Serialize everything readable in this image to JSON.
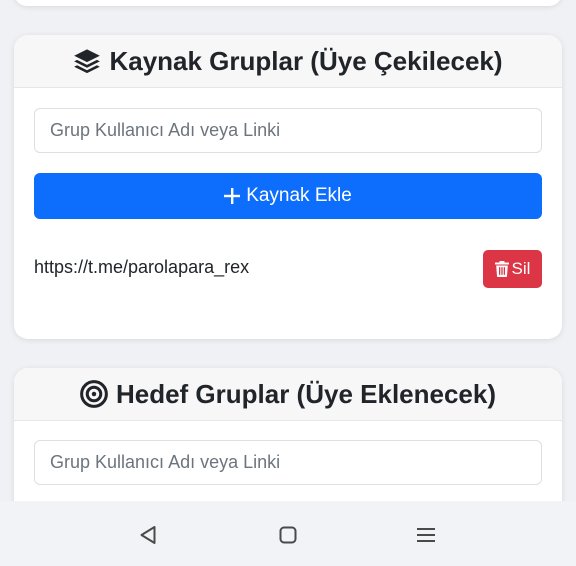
{
  "source_card": {
    "title": "Kaynak Gruplar (Üye Çekilecek)",
    "icon": "layers-icon",
    "input_placeholder": "Grup Kullanıcı Adı veya Linki",
    "add_button_label": "Kaynak Ekle",
    "items": [
      {
        "link": "https://t.me/parolapara_rex",
        "delete_label": "Sil"
      }
    ]
  },
  "target_card": {
    "title": "Hedef Gruplar (Üye Eklenecek)",
    "icon": "bullseye-icon",
    "input_placeholder": "Grup Kullanıcı Adı veya Linki"
  },
  "navigation_bar": {
    "buttons": [
      "back-icon",
      "home-icon",
      "menu-icon"
    ]
  },
  "colors": {
    "primary": "#0d6efd",
    "danger": "#dc3545",
    "background": "#f0f1f4",
    "card_header": "#f7f7f8"
  }
}
